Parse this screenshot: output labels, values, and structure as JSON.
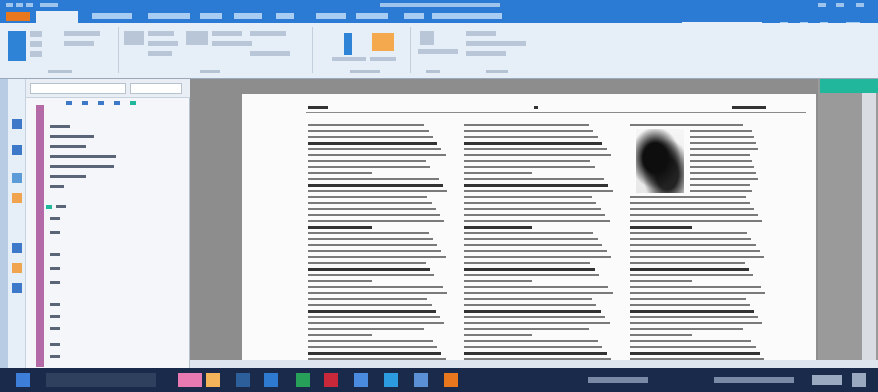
{
  "colors": {
    "titlebar": "#2b7bd4",
    "file_tab": "#e8771e",
    "ribbon": "#e6eef8",
    "nav_strip": "#b56aa8",
    "canvas": "#8d8d8d",
    "page": "#fbfbfb",
    "accent_teal": "#20b79c",
    "taskbar": "#1a2a4a"
  },
  "icons": [
    "save-icon",
    "undo-icon",
    "redo-icon",
    "search-icon",
    "user-avatar-icon",
    "minimize-icon",
    "maximize-icon",
    "close-icon",
    "page-thumbnails-icon",
    "bookmark-icon",
    "photo-icon",
    "start-icon",
    "task-app-icon"
  ]
}
